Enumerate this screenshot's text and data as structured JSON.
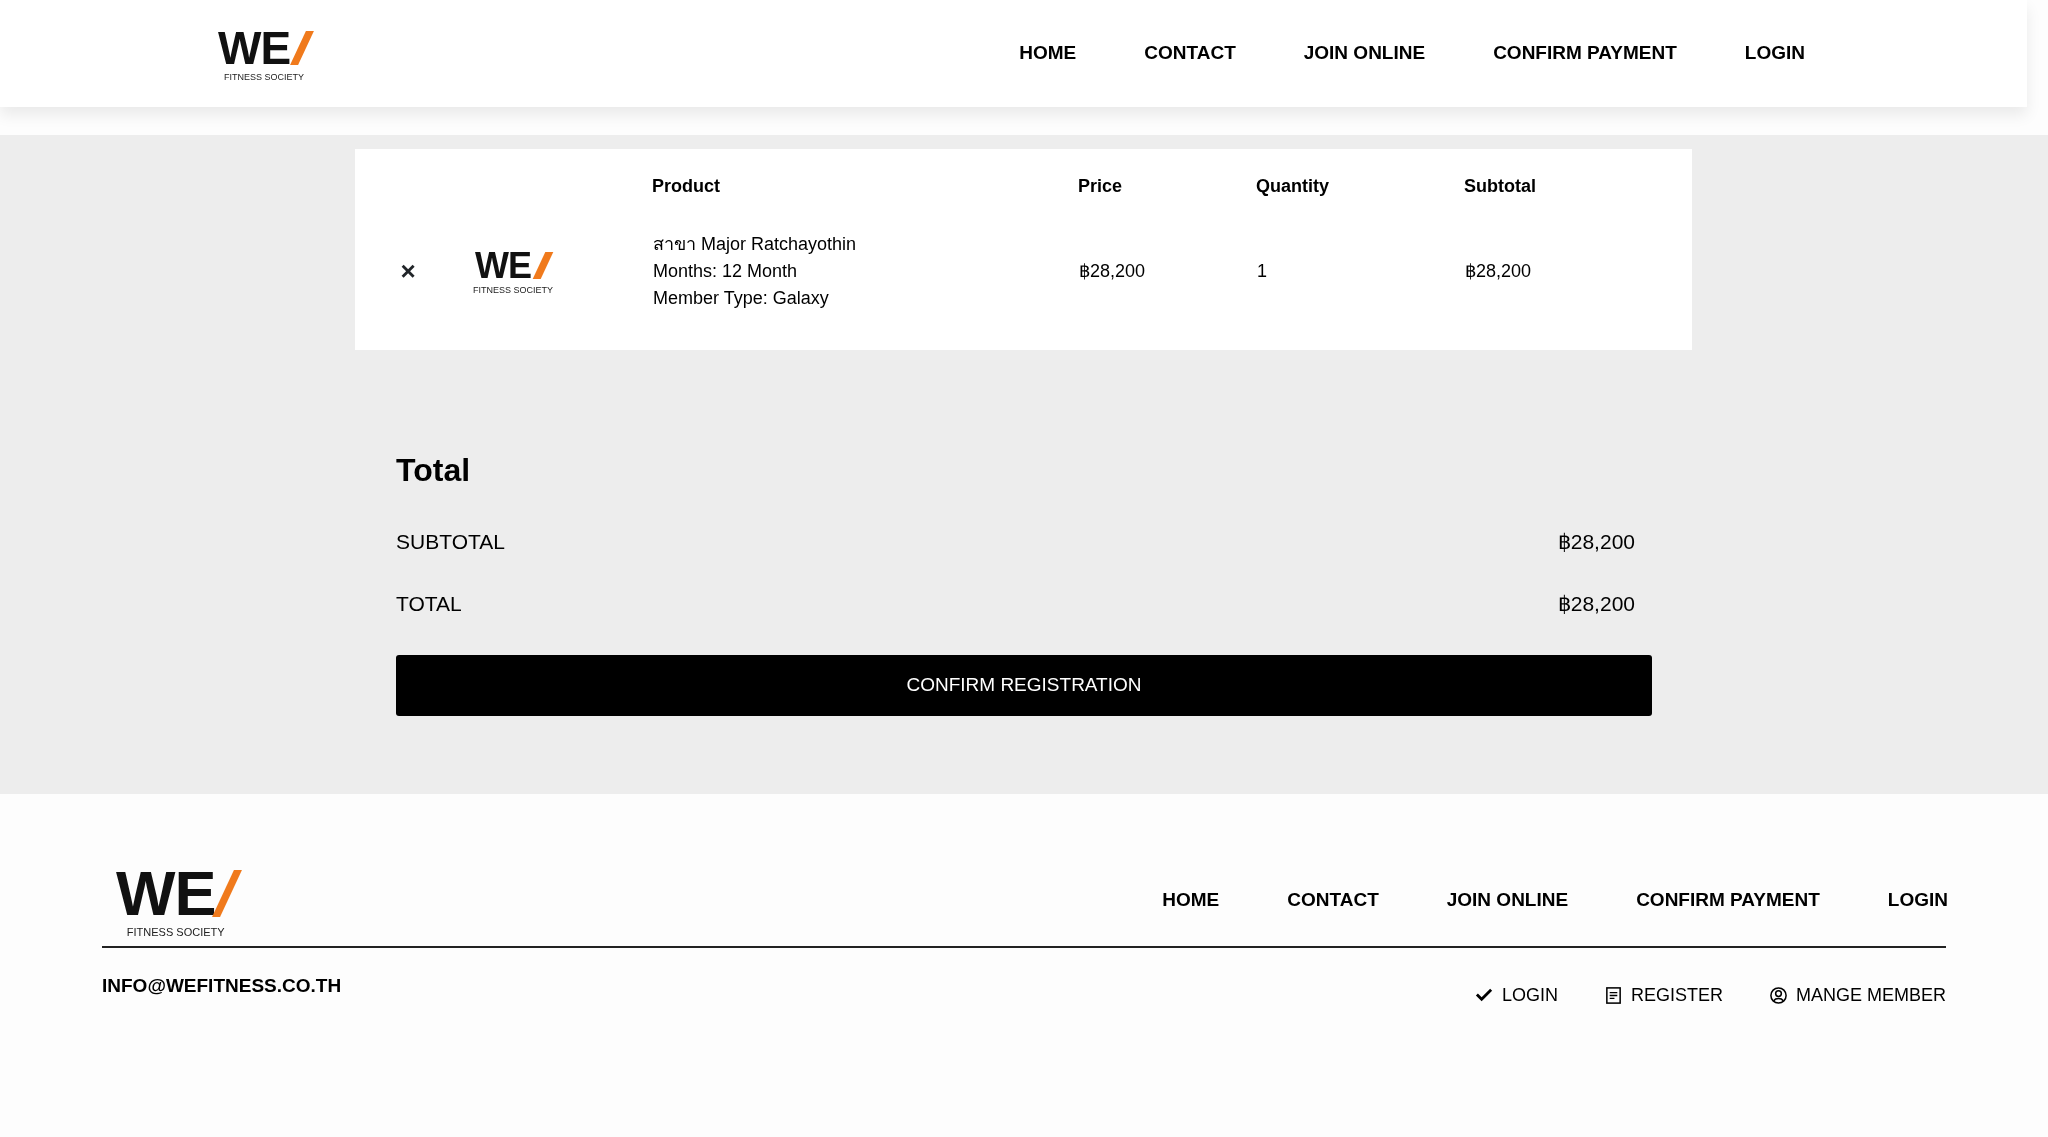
{
  "header": {
    "logo": {
      "mark": "WE",
      "tagline": "FITNESS SOCIETY"
    },
    "nav": [
      "HOME",
      "CONTACT",
      "JOIN ONLINE",
      "CONFIRM PAYMENT",
      "LOGIN"
    ]
  },
  "cart": {
    "columns": [
      "Product",
      "Price",
      "Quantity",
      "Subtotal"
    ],
    "rows": [
      {
        "remove": "×",
        "logo": {
          "mark": "WE",
          "tagline": "FITNESS SOCIETY"
        },
        "details": [
          "สาขา Major Ratchayothin",
          "Months: 12 Month",
          "Member Type: Galaxy"
        ],
        "price": "฿28,200",
        "quantity": "1",
        "subtotal": "฿28,200"
      }
    ]
  },
  "totals": {
    "title": "Total",
    "lines": [
      {
        "label": "SUBTOTAL",
        "value": "฿28,200"
      },
      {
        "label": "TOTAL",
        "value": "฿28,200"
      }
    ],
    "button": "CONFIRM REGISTRATION"
  },
  "footer": {
    "logo": {
      "mark": "WE",
      "tagline": "FITNESS SOCIETY"
    },
    "nav": [
      "HOME",
      "CONTACT",
      "JOIN ONLINE",
      "CONFIRM PAYMENT",
      "LOGIN"
    ],
    "email": "INFO@WEFITNESS.CO.TH",
    "links": [
      {
        "kind": "check",
        "label": "LOGIN"
      },
      {
        "kind": "form",
        "label": "REGISTER"
      },
      {
        "kind": "user",
        "label": "MANGE MEMBER"
      }
    ]
  }
}
